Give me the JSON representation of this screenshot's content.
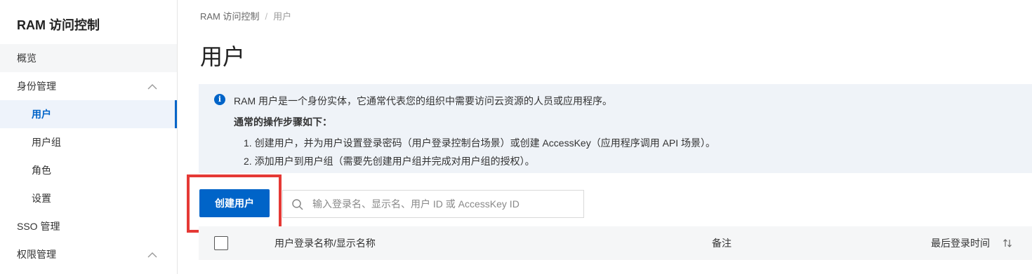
{
  "sidebar": {
    "title": "RAM 访问控制",
    "items": [
      {
        "label": "概览"
      },
      {
        "label": "身份管理"
      },
      {
        "label": "用户"
      },
      {
        "label": "用户组"
      },
      {
        "label": "角色"
      },
      {
        "label": "设置"
      },
      {
        "label": "SSO 管理"
      },
      {
        "label": "权限管理"
      }
    ]
  },
  "breadcrumb": {
    "root": "RAM 访问控制",
    "separator": "/",
    "current": "用户"
  },
  "page": {
    "title": "用户"
  },
  "info": {
    "icon": "info-icon",
    "line1": "RAM 用户是一个身份实体，它通常代表您的组织中需要访问云资源的人员或应用程序。",
    "line2": "通常的操作步骤如下：",
    "line3": "1. 创建用户，并为用户设置登录密码（用户登录控制台场景）或创建 AccessKey（应用程序调用 API 场景）。",
    "line4": "2. 添加用户到用户组（需要先创建用户组并完成对用户组的授权）。"
  },
  "toolbar": {
    "create_label": "创建用户",
    "search_placeholder": "输入登录名、显示名、用户 ID 或 AccessKey ID"
  },
  "table": {
    "columns": [
      "用户登录名称/显示名称",
      "备注",
      "最后登录时间"
    ]
  },
  "colors": {
    "primary": "#0064c8",
    "highlight": "#e53935",
    "info_bg": "#eff3f8"
  }
}
